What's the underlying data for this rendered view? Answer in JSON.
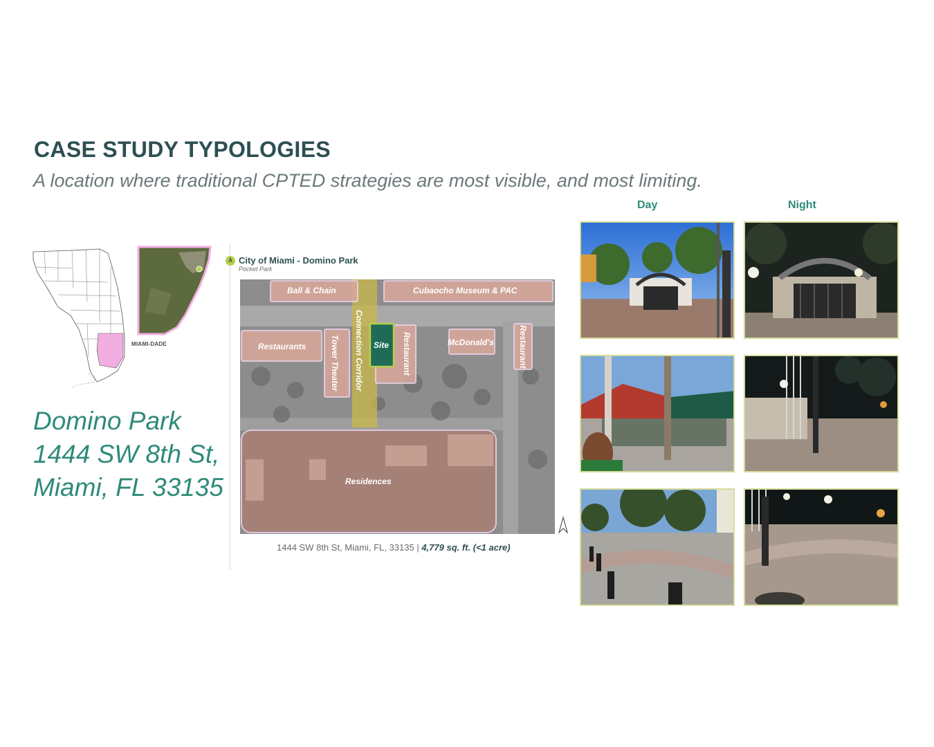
{
  "header": {
    "title": "CASE STUDY TYPOLOGIES",
    "subtitle": "A location where traditional CPTED strategies are most visible, and most limiting."
  },
  "locator": {
    "county_label": "MIAMI-DADE",
    "highlight_color": "#f2aee0"
  },
  "address": {
    "lines": [
      "Domino Park",
      "1444 SW 8th St,",
      "Miami, FL 33135"
    ]
  },
  "site_map": {
    "badge": "A",
    "heading": "City of Miami - Domino Park",
    "subheading": "Pocket Park",
    "labels": {
      "ball_chain": "Ball & Chain",
      "cubaocho": "Cubaocho Museum & PAC",
      "restaurants": "Restaurants",
      "tower_theater": "Tower Theater",
      "connection_corridor": "Connection Corridor",
      "site": "Site",
      "restaurant_center": "Restaurant",
      "mcdonalds": "McDonald's",
      "restaurant_right": "Restaurant",
      "residences": "Residences"
    },
    "footer_address": "1444 SW 8th St, Miami, FL, 33135 |",
    "footer_area": " 4,779 sq. ft. (<1 acre)"
  },
  "photos": {
    "day_label": "Day",
    "night_label": "Night",
    "frame_color": "#d5dc9a"
  },
  "colors": {
    "title": "#2d4f52",
    "accent": "#2f8a7a",
    "site_green": "#1f6b57",
    "corridor_yellow": "#c9b84a",
    "building_pink": "#d7a79a"
  }
}
